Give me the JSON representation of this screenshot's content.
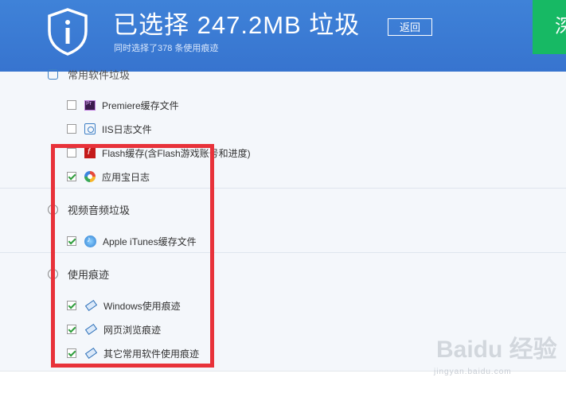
{
  "header": {
    "title": "已选择 247.2MB 垃圾",
    "back_label": "返回",
    "subtitle": "同时选择了378 条使用痕迹",
    "clean_label": "深"
  },
  "sections": {
    "common_software": {
      "title": "常用软件垃圾",
      "items": [
        {
          "label": "Premiere缓存文件",
          "checked": false,
          "icon": "premiere-icon"
        },
        {
          "label": "IIS日志文件",
          "checked": false,
          "icon": "iis-icon"
        },
        {
          "label": "Flash缓存(含Flash游戏账号和进度)",
          "checked": false,
          "icon": "flash-icon"
        },
        {
          "label": "应用宝日志",
          "checked": true,
          "icon": "yingyongbao-icon"
        }
      ]
    },
    "video_audio": {
      "title": "视频音频垃圾",
      "items": [
        {
          "label": "Apple iTunes缓存文件",
          "checked": true,
          "icon": "itunes-icon"
        }
      ]
    },
    "usage_traces": {
      "title": "使用痕迹",
      "items": [
        {
          "label": "Windows使用痕迹",
          "checked": true,
          "icon": "eraser-icon"
        },
        {
          "label": "网页浏览痕迹",
          "checked": true,
          "icon": "eraser-icon"
        },
        {
          "label": "其它常用软件使用痕迹",
          "checked": true,
          "icon": "eraser-icon"
        }
      ]
    }
  },
  "watermark": {
    "text": "Baidu 经验",
    "sub": "jingyan.baidu.com"
  },
  "colors": {
    "header_blue": "#3a7ad4",
    "clean_green": "#17b964",
    "highlight_red": "#e8323a",
    "check_green": "#2f9e3c"
  }
}
